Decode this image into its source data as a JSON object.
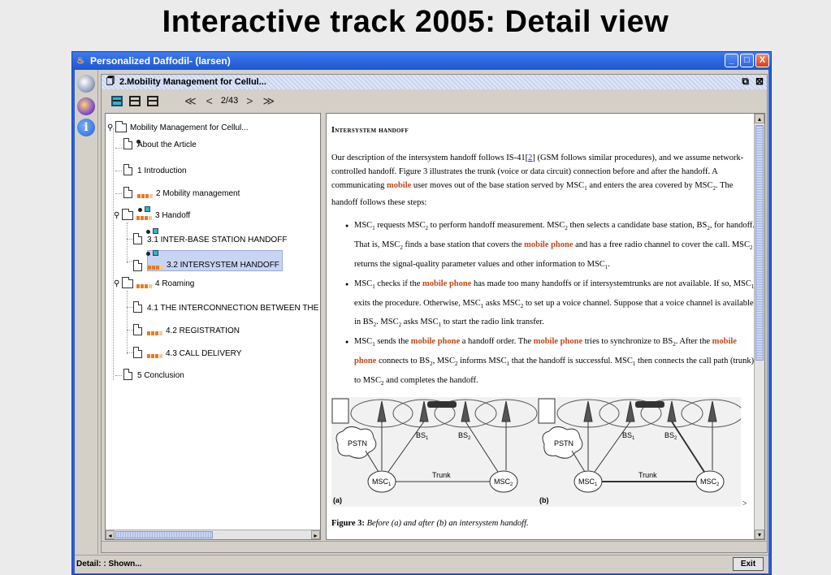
{
  "slide": {
    "title": "Interactive track 2005: Detail view"
  },
  "window": {
    "title": "Personalized Daffodil- (larsen)",
    "controls": {
      "minimize": "_",
      "maximize": "□",
      "close": "X"
    }
  },
  "left_toolbar": {
    "info_glyph": "i"
  },
  "document": {
    "tab_title": "2.Mobility Management for Cellul...",
    "nav": {
      "first": "≪",
      "prev": "<",
      "page": "2/43",
      "next": ">",
      "last": "≫"
    }
  },
  "tree": {
    "items": [
      {
        "label": "Mobility Management for Cellul..."
      },
      {
        "label": "About the Article"
      },
      {
        "label": "1 Introduction"
      },
      {
        "label": "2 Mobility management"
      },
      {
        "label": "3 Handoff"
      },
      {
        "label": "3.1 INTER-BASE STATION HANDOFF"
      },
      {
        "label": "3.2 INTERSYSTEM HANDOFF"
      },
      {
        "label": "4 Roaming"
      },
      {
        "label": "4.1 THE INTERCONNECTION BETWEEN THE"
      },
      {
        "label": "4.2 REGISTRATION"
      },
      {
        "label": "4.3 CALL DELIVERY"
      },
      {
        "label": "5 Conclusion"
      }
    ]
  },
  "content": {
    "heading": "Intersystem handoff",
    "paragraph": {
      "p1": "Our description of the intersystem handoff follows IS-41[",
      "ref": "2",
      "p2": "] (GSM follows similar procedures), and we assume network-controlled handoff. Figure 3 illustrates the trunk (voice or data circuit) connection before and after the handoff. A communicating ",
      "hl1": "mobile",
      "p3": " user moves out of the base station served by MSC",
      "s1": "1",
      "p4": " and enters the area covered by MSC",
      "s2": "2",
      "p5": ". The handoff follows these steps:"
    },
    "bullet1": {
      "a": "MSC",
      "s1": "1",
      "b": " requests MSC",
      "s2": "2",
      "c": " to perform handoff measurement. MSC",
      "s3": "2",
      "d": " then selects a candidate base station, BS",
      "s4": "2",
      "e": ", for handoff. That is, MSC",
      "s5": "2",
      "f": " finds a base station that covers the ",
      "hl": "mobile phone",
      "g": " and has a free radio channel to cover the call. MSC",
      "s6": "2",
      "h": " returns the signal-quality parameter values and other information to MSC",
      "s7": "1",
      "i": "."
    },
    "bullet2": {
      "a": "MSC",
      "s1": "1",
      "b": " checks if the ",
      "hl": "mobile phone",
      "c": " has made too many handoffs or if intersystemtrunks are not available. If so, MSC",
      "s2": "1",
      "d": " exits the procedure. Otherwise, MSC",
      "s3": "1",
      "e": " asks MSC",
      "s4": "2",
      "f": " to set up a voice channel. Suppose that a voice channel is available in BS",
      "s5": "2",
      "g": ". MSC",
      "s6": "2",
      "h": " asks MSC",
      "s7": "1",
      "i": " to start the radio link transfer."
    },
    "bullet3": {
      "a": "MSC",
      "s1": "1",
      "b": " sends the ",
      "hl1": "mobile phone",
      "c": " a handoff order. The ",
      "hl2": "mobile phone",
      "d": " tries to synchronize to BS",
      "s2": "2",
      "e": ". After the ",
      "hl3": "mobile phone",
      "f": " connects to BS",
      "s3": "2",
      "g": ", MSC",
      "s4": "2",
      "h": " informs MSC",
      "s5": "1",
      "i": " that the handoff is successful. MSC",
      "s6": "1",
      "j": " then connects the call path (trunk) to MSC",
      "s7": "2",
      "k": " and completes the handoff."
    },
    "figure": {
      "pstn": "PSTN",
      "msc": "MSC",
      "one": "1",
      "two": "2",
      "bs": "BS",
      "trunk": "Trunk",
      "label_a": "(a)",
      "label_b": "(b)",
      "more": ">"
    },
    "caption": {
      "label": "Figure 3:",
      "text": "Before (a) and after (b) an intersystem handoff."
    }
  },
  "status": {
    "text": "Detail: : Shown...",
    "exit": "Exit"
  }
}
